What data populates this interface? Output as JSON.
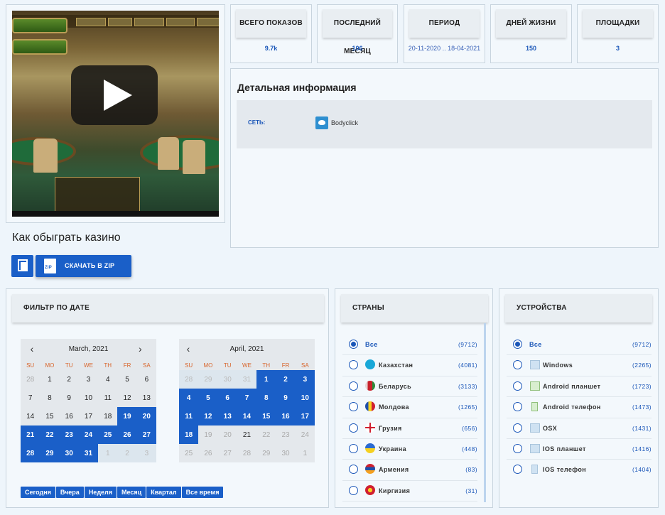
{
  "video": {
    "play_label": "play"
  },
  "stats": [
    {
      "label": "ВСЕГО ПОКАЗОВ",
      "value": "9.7k"
    },
    {
      "label": "ПОСЛЕДНИЙ МЕСЯЦ",
      "value": "106"
    },
    {
      "label": "ПЕРИОД",
      "value": "20-11-2020 .. 18-04-2021"
    },
    {
      "label": "ДНЕЙ ЖИЗНИ",
      "value": "150"
    },
    {
      "label": "ПЛОЩАДКИ",
      "value": "3"
    }
  ],
  "detail": {
    "title": "Детальная информация",
    "network_label": "СЕТЬ:",
    "network_value": "Bodyclick"
  },
  "ad_title": "Как обыграть казино",
  "zip_label": "СКАЧАТЬ В ZIP",
  "filter": {
    "title": "ФИЛЬТР ПО ДАТЕ",
    "dow": [
      "SU",
      "MO",
      "TU",
      "WE",
      "TH",
      "FR",
      "SA"
    ],
    "cal1": {
      "title": "March, 2021"
    },
    "cal2": {
      "title": "April, 2021"
    },
    "quick": [
      "Сегодня",
      "Вчера",
      "Неделя",
      "Месяц",
      "Квартал",
      "Все время"
    ]
  },
  "countries": {
    "title": "СТРАНЫ",
    "items": [
      {
        "label": "Все",
        "count": "(9712)"
      },
      {
        "label": "Казахстан",
        "count": "(4081)"
      },
      {
        "label": "Беларусь",
        "count": "(3133)"
      },
      {
        "label": "Молдова",
        "count": "(1265)"
      },
      {
        "label": "Грузия",
        "count": "(656)"
      },
      {
        "label": "Украина",
        "count": "(448)"
      },
      {
        "label": "Армения",
        "count": "(83)"
      },
      {
        "label": "Киргизия",
        "count": "(31)"
      }
    ]
  },
  "devices": {
    "title": "УСТРОЙСТВА",
    "items": [
      {
        "label": "Все",
        "count": "(9712)"
      },
      {
        "label": "Windows",
        "count": "(2265)"
      },
      {
        "label": "Android планшет",
        "count": "(1723)"
      },
      {
        "label": "Android телефон",
        "count": "(1473)"
      },
      {
        "label": "OSX",
        "count": "(1431)"
      },
      {
        "label": "IOS планшет",
        "count": "(1416)"
      },
      {
        "label": "IOS телефон",
        "count": "(1404)"
      }
    ]
  }
}
